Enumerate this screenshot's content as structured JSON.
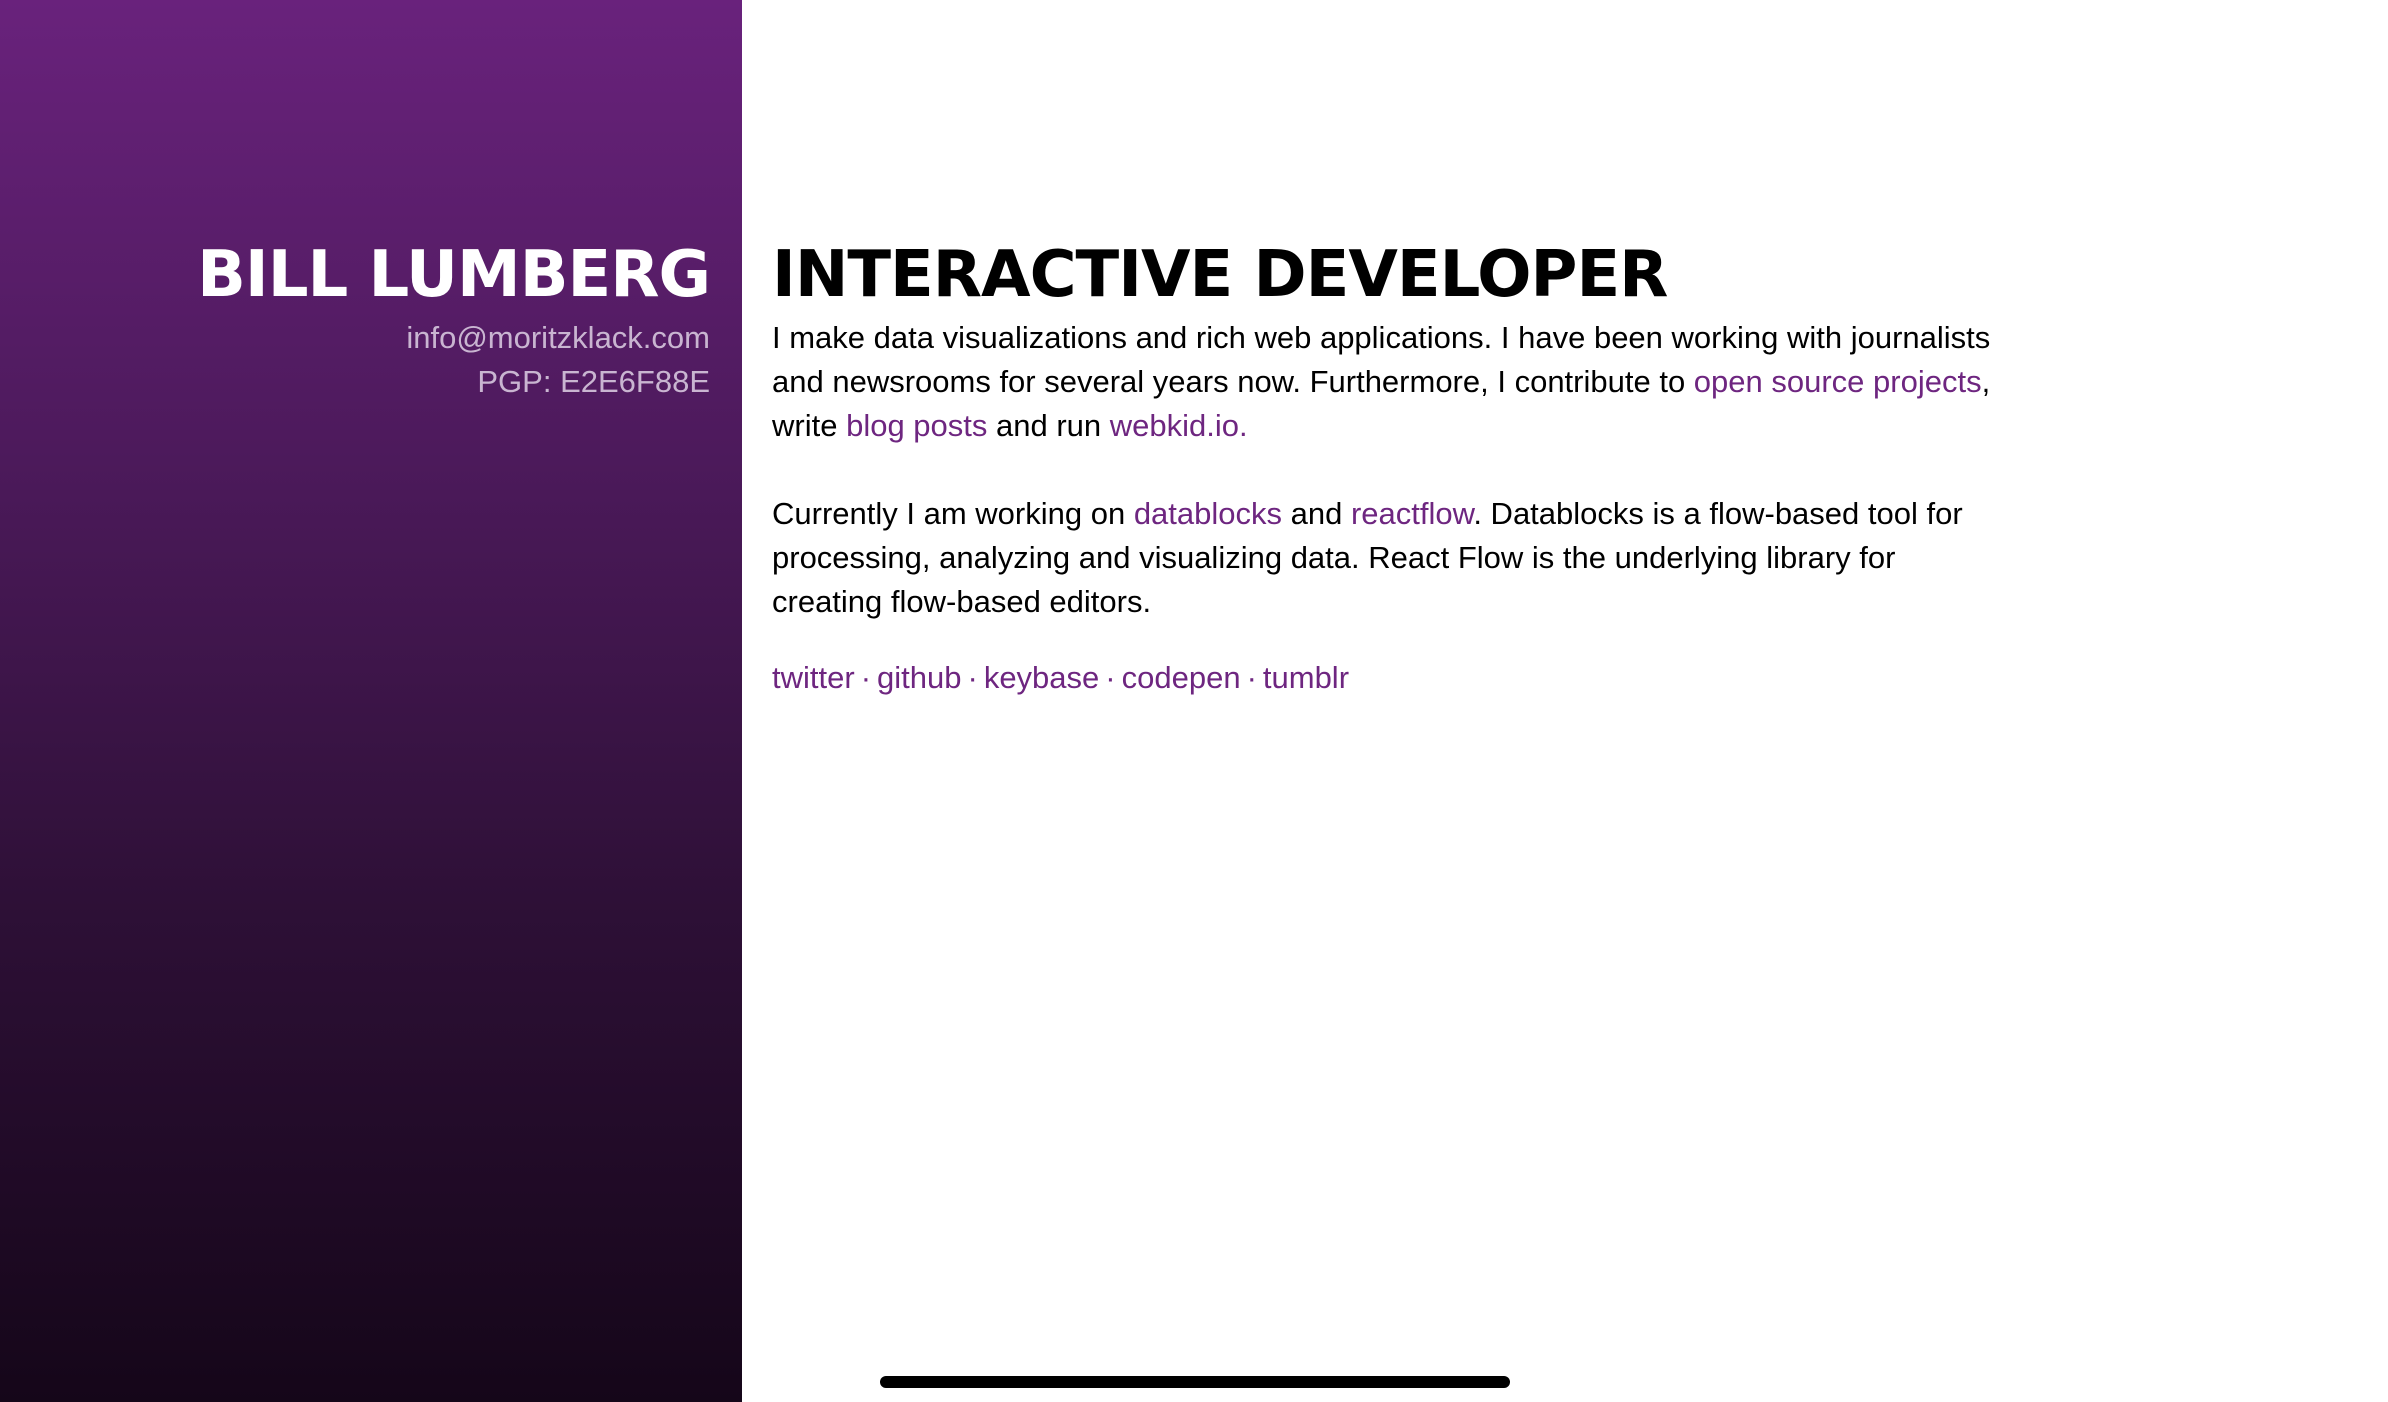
{
  "sidebar": {
    "name": "BILL LUMBERG",
    "email": "info@moritzklack.com",
    "pgp": "PGP: E2E6F88E",
    "gradient_top": "#69227c",
    "gradient_bottom": "#150619"
  },
  "main": {
    "title": "INTERACTIVE DEVELOPER",
    "para1": {
      "text1": "I make data visualizations and rich web applications. I have been working with journalists and newsrooms for several years now. Furthermore, I contribute to ",
      "link_open_source": "open source projects",
      "text2": ", write ",
      "link_blog": "blog posts",
      "text3": " and run ",
      "link_webkid": "webkid.io."
    },
    "para2": {
      "text1": "Currently I am working on ",
      "link_datablocks": "datablocks",
      "text2": " and ",
      "link_reactflow": "reactflow",
      "text3": ". Datablocks is a flow-based tool for processing, analyzing and visualizing data. React Flow is the underlying library for creating flow-based editors."
    },
    "social": {
      "twitter": "twitter",
      "github": "github",
      "keybase": "keybase",
      "codepen": "codepen",
      "tumblr": "tumblr",
      "separator": "·"
    }
  },
  "colors": {
    "link": "#6e2680",
    "text": "#000000",
    "background": "#ffffff"
  }
}
